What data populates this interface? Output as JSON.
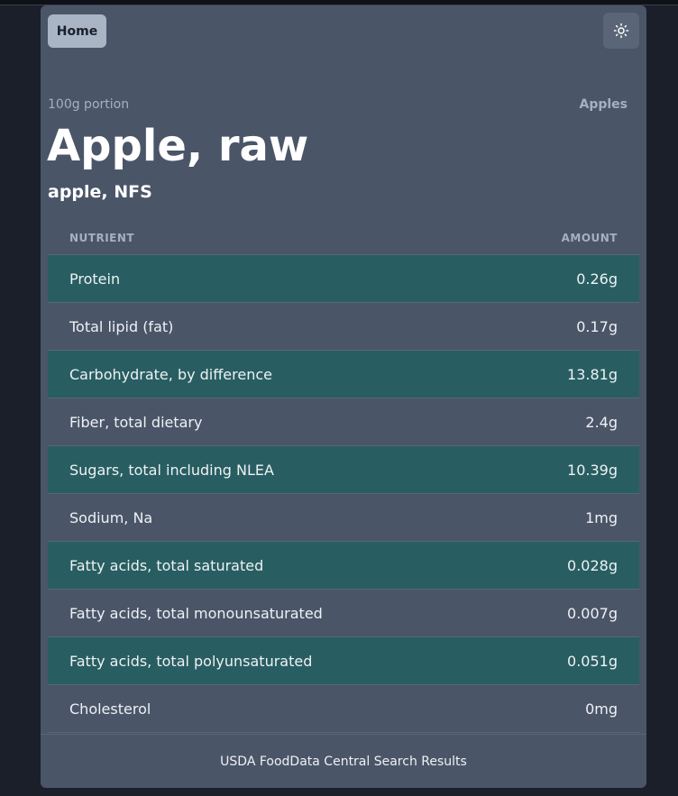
{
  "header": {
    "home_label": "Home",
    "theme_icon": "sun-icon"
  },
  "food": {
    "portion": "100g portion",
    "category": "Apples",
    "title": "Apple, raw",
    "subtitle": "apple, NFS"
  },
  "table": {
    "col_nutrient": "NUTRIENT",
    "col_amount": "AMOUNT",
    "rows": [
      {
        "nutrient": "Protein",
        "amount": "0.26g"
      },
      {
        "nutrient": "Total lipid (fat)",
        "amount": "0.17g"
      },
      {
        "nutrient": "Carbohydrate, by difference",
        "amount": "13.81g"
      },
      {
        "nutrient": "Fiber, total dietary",
        "amount": "2.4g"
      },
      {
        "nutrient": "Sugars, total including NLEA",
        "amount": "10.39g"
      },
      {
        "nutrient": "Sodium, Na",
        "amount": "1mg"
      },
      {
        "nutrient": "Fatty acids, total saturated",
        "amount": "0.028g"
      },
      {
        "nutrient": "Fatty acids, total monounsaturated",
        "amount": "0.007g"
      },
      {
        "nutrient": "Fatty acids, total polyunsaturated",
        "amount": "0.051g"
      },
      {
        "nutrient": "Cholesterol",
        "amount": "0mg"
      }
    ]
  },
  "footer": {
    "text": "USDA FoodData Central Search Results"
  },
  "colors": {
    "card_bg": "#4a5568",
    "row_highlight": "#285e61",
    "page_bg": "#1b1f2a"
  }
}
